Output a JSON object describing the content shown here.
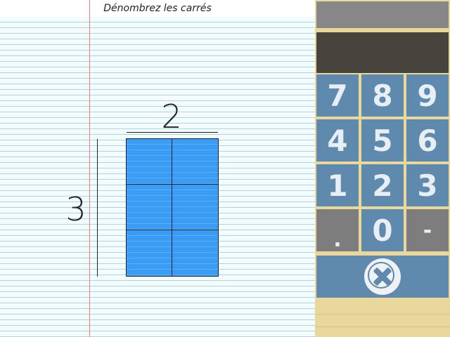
{
  "worksheet": {
    "title": "Dénombrez les carrés",
    "columns_label": "2",
    "rows_label": "3",
    "grid": {
      "rows": 3,
      "columns": 2
    }
  },
  "keypad": {
    "display_top": "",
    "display_main": "",
    "keys": [
      "7",
      "8",
      "9",
      "4",
      "5",
      "6",
      "1",
      "2",
      "3",
      ".",
      "0",
      "-"
    ],
    "clear_icon": "close-circle-icon"
  },
  "colors": {
    "grid_fill": "#3b9cf5",
    "key_blue": "#5f89ad",
    "key_gray": "#7d7d7d",
    "panel_bg": "#e9d79b",
    "display_dark": "#47443e",
    "margin_line": "#f07b7b"
  }
}
